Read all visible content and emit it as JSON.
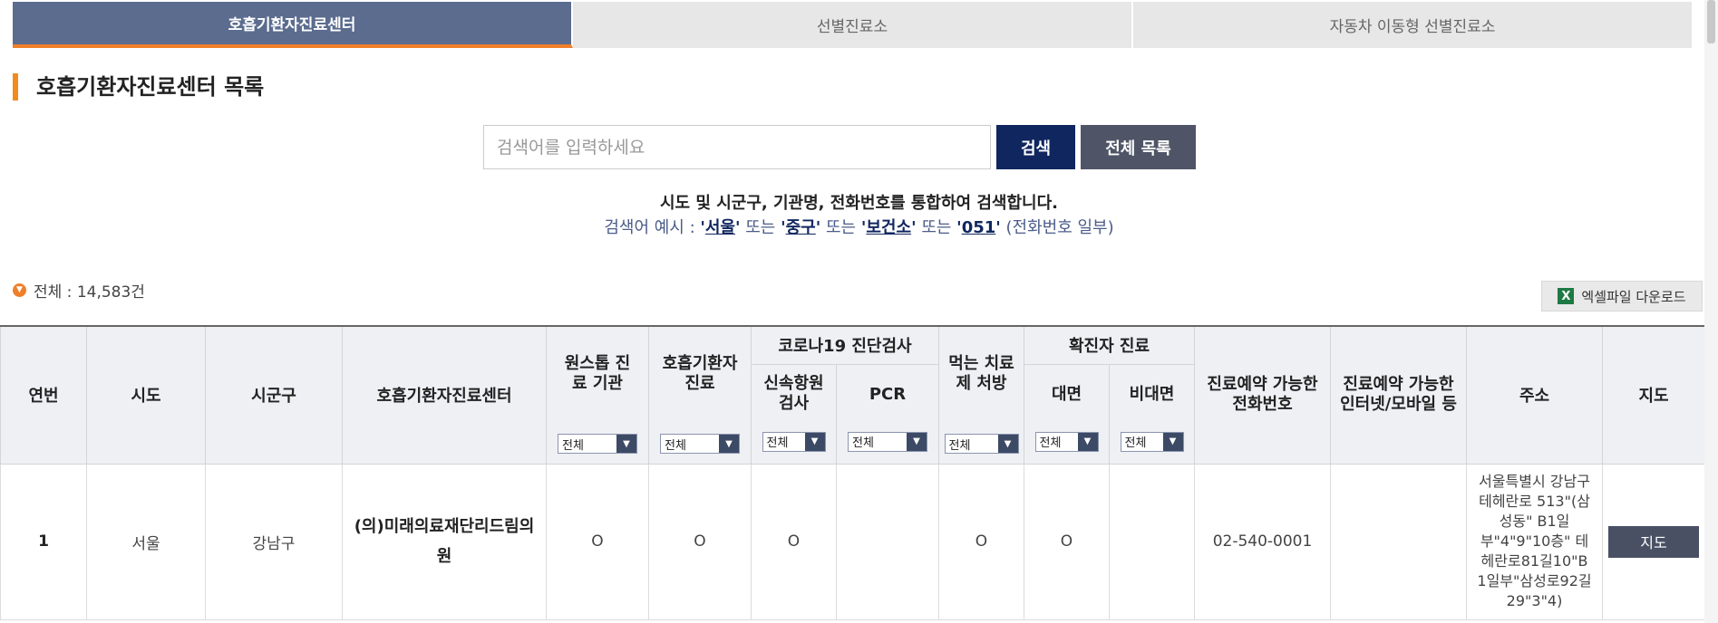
{
  "tabs": [
    "호흡기환자진료센터",
    "선별진료소",
    "자동차 이동형 선별진료소"
  ],
  "section_title": "호흡기환자진료센터 목록",
  "search": {
    "placeholder": "검색어를 입력하세요",
    "search_label": "검색",
    "all_label": "전체 목록"
  },
  "guide": {
    "line1": "시도 및 시군구, 기관명, 전화번호를 통합하여 검색합니다.",
    "prefix": "검색어 예시 : ",
    "ex1": "서울",
    "ex2": "중구",
    "ex3": "보건소",
    "ex4": "051",
    "or": "또는",
    "suffix": "(전화번호 일부)"
  },
  "total_text": "전체 : 14,583건",
  "excel_label": "엑셀파일 다운로드",
  "table": {
    "headers": {
      "no": "연번",
      "sido": "시도",
      "sigungu": "시군구",
      "center": "호흡기환자진료센터",
      "onestop": "원스톱 진료 기관",
      "resp": "호흡기환자 진료",
      "covid_test": "코로나19 진단검사",
      "rapid": "신속항원 검사",
      "pcr": "PCR",
      "oral": "먹는 치료제 처방",
      "confirmed": "확진자 진료",
      "face": "대면",
      "nonface": "비대면",
      "phone": "진료예약 가능한 전화번호",
      "internet": "진료예약 가능한 인터넷/모바일 등",
      "address": "주소",
      "map": "지도"
    },
    "filter_value": "전체",
    "rows": [
      {
        "no": "1",
        "sido": "서울",
        "sigungu": "강남구",
        "center": "(의)미래의료재단리드림의원",
        "onestop": "O",
        "resp": "O",
        "rapid": "O",
        "pcr": "",
        "oral": "O",
        "face": "O",
        "nonface": "",
        "phone": "02-540-0001",
        "internet": "",
        "address": "서울특별시 강남구 테헤란로 513\"(삼성동\" B1일부\"4\"9\"10층\" 테헤란로81길10\"B 1일부\"삼성로92길 29\"3\"4)",
        "map_label": "지도"
      }
    ]
  },
  "colors": {
    "active_tab": "#5b6c8f",
    "accent_orange": "#f07f2a",
    "search_btn": "#10265f",
    "dark_btn": "#4f5566"
  }
}
